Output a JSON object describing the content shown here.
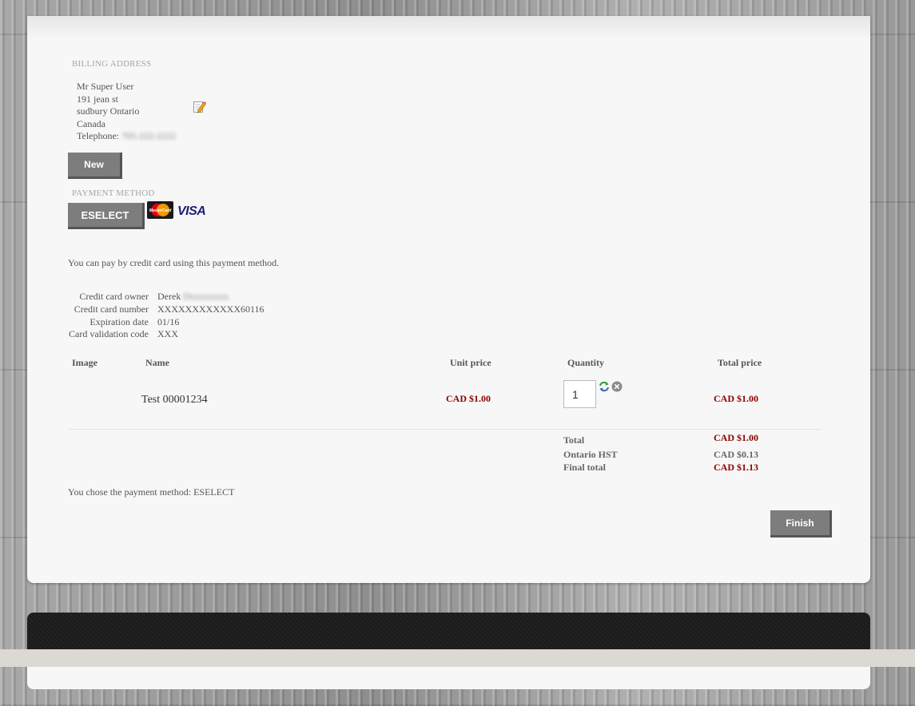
{
  "billing": {
    "heading": "BILLING ADDRESS",
    "name": "Mr Super User",
    "street": "191 jean st",
    "city_line": "sudbury Ontario",
    "country": "Canada",
    "telephone_label": "Telephone:",
    "telephone_value": "705-222-2222",
    "new_button": "New"
  },
  "payment": {
    "heading": "PAYMENT METHOD",
    "method_button": "ESELECT",
    "card_logos": [
      "MasterCard",
      "VISA"
    ],
    "description": "You can pay by credit card using this payment method."
  },
  "card": {
    "owner_label": "Credit card owner",
    "owner_first": "Derek",
    "owner_last": "Dxxxxxxxx",
    "number_label": "Credit card number",
    "number_value": "XXXXXXXXXXXX60116",
    "expiry_label": "Expiration date",
    "expiry_value": "01/16",
    "cvc_label": "Card validation code",
    "cvc_value": "XXX"
  },
  "cart": {
    "headers": {
      "image": "Image",
      "name": "Name",
      "unit_price": "Unit price",
      "quantity": "Quantity",
      "total_price": "Total price"
    },
    "items": [
      {
        "name": "Test 00001234",
        "unit_price": "CAD $1.00",
        "quantity": "1",
        "total_price": "CAD $1.00"
      }
    ],
    "total_label": "Total",
    "total_value": "CAD $1.00",
    "tax_label": "Ontario HST",
    "tax_value": "CAD $0.13",
    "final_label": "Final total",
    "final_value": "CAD $1.13"
  },
  "chosen_text": "You chose the payment method: ESELECT",
  "finish_button": "Finish",
  "colors": {
    "price": "#8b0000",
    "button": "#7d7d7d",
    "panel": "#f7f7f7"
  },
  "icons": [
    "edit-icon",
    "refresh-icon",
    "remove-icon",
    "mastercard-logo",
    "visa-logo"
  ]
}
